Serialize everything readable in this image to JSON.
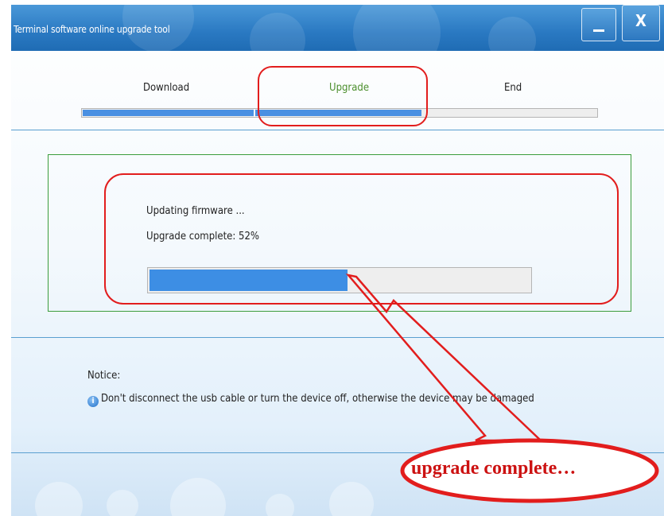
{
  "window": {
    "title": "Terminal software online upgrade tool",
    "minimize_icon": "minimize-icon",
    "close_icon": "close-icon",
    "close_glyph": "X"
  },
  "steps": [
    {
      "label": "Download",
      "state": "done"
    },
    {
      "label": "Upgrade",
      "state": "active"
    },
    {
      "label": "End",
      "state": "pending"
    }
  ],
  "step_progress": 0.66,
  "status": {
    "line1": "Updating firmware ...",
    "line2": "Upgrade complete: 52%",
    "progress": 0.52
  },
  "notice": {
    "label": "Notice:",
    "icon": "info-icon",
    "text": "Don't disconnect the usb cable or turn the device off, otherwise the device may be damaged"
  },
  "annotation": {
    "callout_text": "upgrade complete…",
    "color": "#e21d1d"
  },
  "colors": {
    "titlebar": "#2a79c2",
    "progress_fill": "#3d8ee4",
    "active_step": "#4c8f2d",
    "panel_border": "#3c9d3c"
  }
}
